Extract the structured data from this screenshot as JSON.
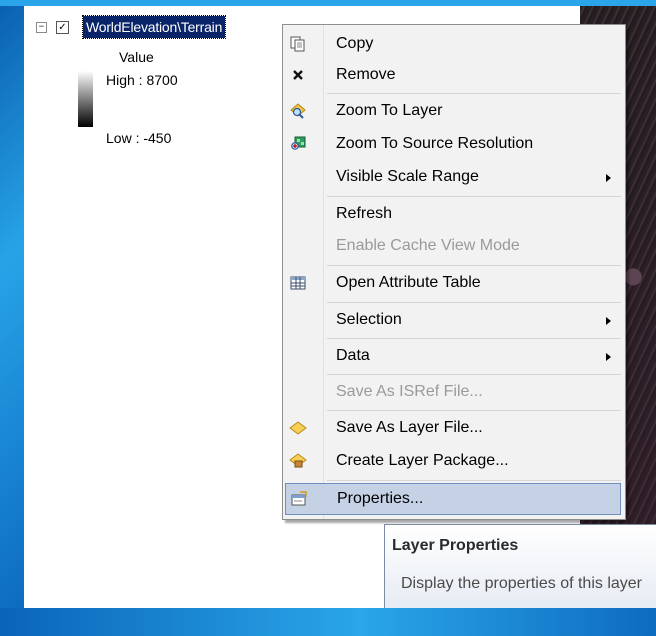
{
  "toc": {
    "tree_toggle": "−",
    "layer_name": "WorldElevation\\Terrain",
    "legend": {
      "field": "Value",
      "high_label": "High : 8700",
      "low_label": "Low : -450"
    }
  },
  "context_menu": {
    "items": [
      {
        "label": "Copy",
        "icon": "copy-icon",
        "enabled": true
      },
      {
        "label": "Remove",
        "icon": "remove-icon",
        "enabled": true
      },
      {
        "label": "Zoom To Layer",
        "icon": "zoom-to-layer-icon",
        "enabled": true
      },
      {
        "label": "Zoom To Source Resolution",
        "icon": "zoom-to-source-resolution-icon",
        "enabled": true
      },
      {
        "label": "Visible Scale Range",
        "icon": null,
        "enabled": true,
        "submenu": true
      },
      {
        "label": "Refresh",
        "icon": null,
        "enabled": true
      },
      {
        "label": "Enable Cache View Mode",
        "icon": null,
        "enabled": false
      },
      {
        "label": "Open Attribute Table",
        "icon": "table-icon",
        "enabled": true
      },
      {
        "label": "Selection",
        "icon": null,
        "enabled": true,
        "submenu": true
      },
      {
        "label": "Data",
        "icon": null,
        "enabled": true,
        "submenu": true
      },
      {
        "label": "Save As ISRef File...",
        "icon": null,
        "enabled": false
      },
      {
        "label": "Save As Layer File...",
        "icon": "layer-file-icon",
        "enabled": true
      },
      {
        "label": "Create Layer Package...",
        "icon": "layer-package-icon",
        "enabled": true
      },
      {
        "label": "Properties...",
        "icon": "properties-icon",
        "enabled": true,
        "highlighted": true
      }
    ]
  },
  "tooltip": {
    "title": "Layer Properties",
    "body": "Display the properties of this layer"
  },
  "colors": {
    "selection": "#0a246a",
    "menu_highlight": "#c5d2e6",
    "frame_blue": "#1e8fd6"
  }
}
